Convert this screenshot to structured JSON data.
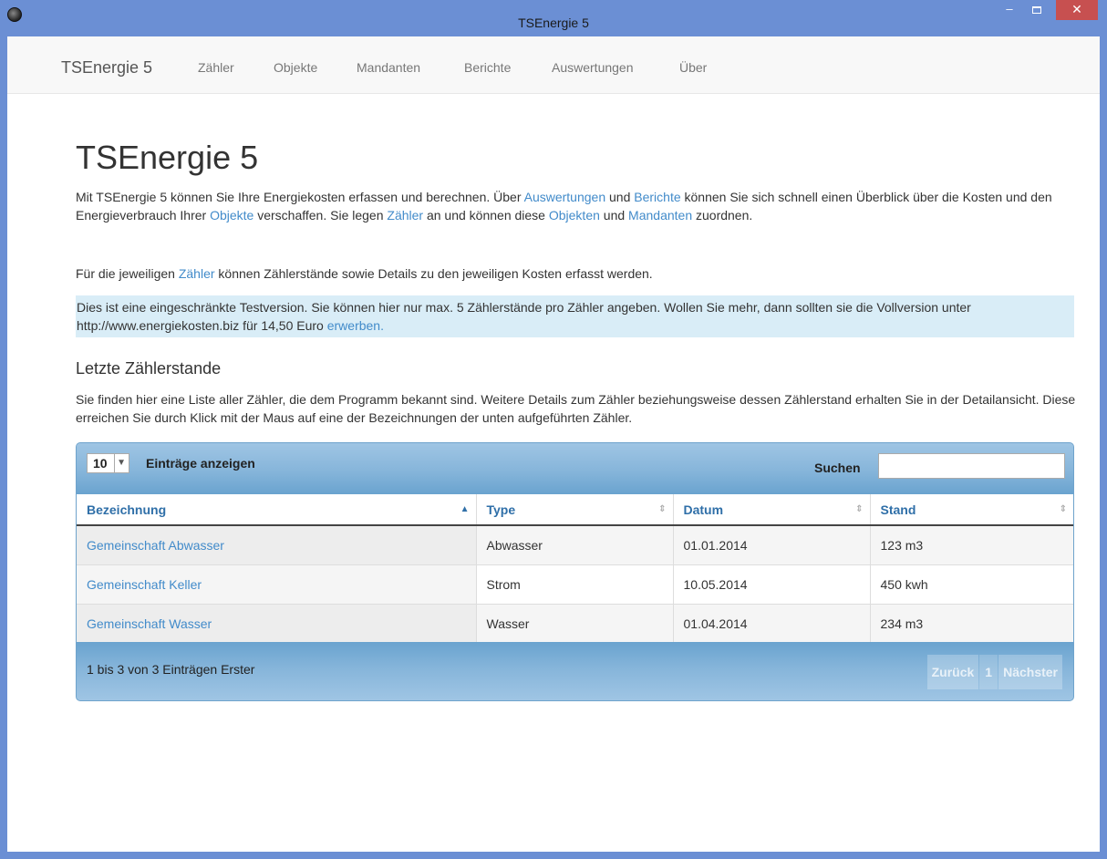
{
  "window": {
    "title": "TSEnergie 5",
    "minimize": "–",
    "maximize": "",
    "close": "✕"
  },
  "navbar": {
    "brand": "TSEnergie 5",
    "links": [
      "Zähler",
      "Objekte",
      "Mandanten",
      "Berichte",
      "Auswertungen",
      "Über"
    ]
  },
  "main": {
    "title": "TSEnergie 5",
    "intro": {
      "t1": "Mit TSEnergie 5 können Sie Ihre Energiekosten erfassen und berechnen. Über ",
      "l1": "Auswertungen",
      "t2": " und ",
      "l2": "Berichte",
      "t3": "  können Sie sich schnell einen Überblick über die Kosten und den Energieverbrauch Ihrer ",
      "l3": "Objekte",
      "t4": "  verschaffen. Sie legen ",
      "l4": "Zähler",
      "t5": "  an und können diese ",
      "l5": "Objekten",
      "t6": "  und ",
      "l6": "Mandanten",
      "t7": "  zuordnen."
    },
    "para2": {
      "t1": "Für die jeweiligen ",
      "l1": "Zähler",
      "t2": " können Zählerstände sowie Details zu den jeweiligen Kosten erfasst werden."
    },
    "alert": {
      "text": "Dies ist eine eingeschränkte Testversion. Sie können hier nur max. 5 Zählerstände pro Zähler angeben. Wollen Sie mehr, dann sollten sie die Vollversion unter http://www.energiekosten.biz für 14,50 Euro ",
      "link": "erwerben."
    },
    "section_title": "Letzte Zählerstande",
    "section_text": "Sie finden hier eine Liste aller Zähler, die dem Programm bekannt sind. Weitere Details zum Zähler beziehungsweise dessen Zählerstand erhalten Sie in der Detailansicht. Diese erreichen Sie durch Klick mit der Maus auf eine der Bezeichnungen der unten aufgeführten Zähler."
  },
  "table": {
    "length_value": "10",
    "length_label": "Einträge anzeigen",
    "search_label": "Suchen",
    "search_value": "",
    "columns": [
      "Bezeichnung",
      "Type",
      "Datum",
      "Stand"
    ],
    "sort_icons": {
      "active": "▲",
      "inactive": "⇕"
    },
    "rows": [
      [
        "Gemeinschaft Abwasser",
        "Abwasser",
        "01.01.2014",
        "123 m3"
      ],
      [
        "Gemeinschaft Keller",
        "Strom",
        "10.05.2014",
        "450 kwh"
      ],
      [
        "Gemeinschaft Wasser",
        "Wasser",
        "01.04.2014",
        "234 m3"
      ]
    ],
    "info": "1 bis 3 von 3 Einträgen Erster",
    "pagination": {
      "prev": "Zurück",
      "current": "1",
      "next": "Nächster"
    }
  },
  "colors": {
    "link": "#428bca",
    "titlebar": "#6b8fd4",
    "close": "#c75050",
    "alert_bg": "#d9edf7",
    "table_chrome": "#87b6d9"
  }
}
